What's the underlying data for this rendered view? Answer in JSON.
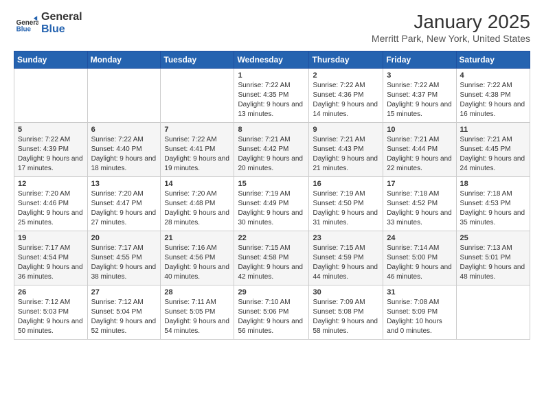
{
  "header": {
    "logo_general": "General",
    "logo_blue": "Blue",
    "title": "January 2025",
    "location": "Merritt Park, New York, United States"
  },
  "days_of_week": [
    "Sunday",
    "Monday",
    "Tuesday",
    "Wednesday",
    "Thursday",
    "Friday",
    "Saturday"
  ],
  "weeks": [
    [
      {
        "day": "",
        "sunrise": "",
        "sunset": "",
        "daylight": ""
      },
      {
        "day": "",
        "sunrise": "",
        "sunset": "",
        "daylight": ""
      },
      {
        "day": "",
        "sunrise": "",
        "sunset": "",
        "daylight": ""
      },
      {
        "day": "1",
        "sunrise": "Sunrise: 7:22 AM",
        "sunset": "Sunset: 4:35 PM",
        "daylight": "Daylight: 9 hours and 13 minutes."
      },
      {
        "day": "2",
        "sunrise": "Sunrise: 7:22 AM",
        "sunset": "Sunset: 4:36 PM",
        "daylight": "Daylight: 9 hours and 14 minutes."
      },
      {
        "day": "3",
        "sunrise": "Sunrise: 7:22 AM",
        "sunset": "Sunset: 4:37 PM",
        "daylight": "Daylight: 9 hours and 15 minutes."
      },
      {
        "day": "4",
        "sunrise": "Sunrise: 7:22 AM",
        "sunset": "Sunset: 4:38 PM",
        "daylight": "Daylight: 9 hours and 16 minutes."
      }
    ],
    [
      {
        "day": "5",
        "sunrise": "Sunrise: 7:22 AM",
        "sunset": "Sunset: 4:39 PM",
        "daylight": "Daylight: 9 hours and 17 minutes."
      },
      {
        "day": "6",
        "sunrise": "Sunrise: 7:22 AM",
        "sunset": "Sunset: 4:40 PM",
        "daylight": "Daylight: 9 hours and 18 minutes."
      },
      {
        "day": "7",
        "sunrise": "Sunrise: 7:22 AM",
        "sunset": "Sunset: 4:41 PM",
        "daylight": "Daylight: 9 hours and 19 minutes."
      },
      {
        "day": "8",
        "sunrise": "Sunrise: 7:21 AM",
        "sunset": "Sunset: 4:42 PM",
        "daylight": "Daylight: 9 hours and 20 minutes."
      },
      {
        "day": "9",
        "sunrise": "Sunrise: 7:21 AM",
        "sunset": "Sunset: 4:43 PM",
        "daylight": "Daylight: 9 hours and 21 minutes."
      },
      {
        "day": "10",
        "sunrise": "Sunrise: 7:21 AM",
        "sunset": "Sunset: 4:44 PM",
        "daylight": "Daylight: 9 hours and 22 minutes."
      },
      {
        "day": "11",
        "sunrise": "Sunrise: 7:21 AM",
        "sunset": "Sunset: 4:45 PM",
        "daylight": "Daylight: 9 hours and 24 minutes."
      }
    ],
    [
      {
        "day": "12",
        "sunrise": "Sunrise: 7:20 AM",
        "sunset": "Sunset: 4:46 PM",
        "daylight": "Daylight: 9 hours and 25 minutes."
      },
      {
        "day": "13",
        "sunrise": "Sunrise: 7:20 AM",
        "sunset": "Sunset: 4:47 PM",
        "daylight": "Daylight: 9 hours and 27 minutes."
      },
      {
        "day": "14",
        "sunrise": "Sunrise: 7:20 AM",
        "sunset": "Sunset: 4:48 PM",
        "daylight": "Daylight: 9 hours and 28 minutes."
      },
      {
        "day": "15",
        "sunrise": "Sunrise: 7:19 AM",
        "sunset": "Sunset: 4:49 PM",
        "daylight": "Daylight: 9 hours and 30 minutes."
      },
      {
        "day": "16",
        "sunrise": "Sunrise: 7:19 AM",
        "sunset": "Sunset: 4:50 PM",
        "daylight": "Daylight: 9 hours and 31 minutes."
      },
      {
        "day": "17",
        "sunrise": "Sunrise: 7:18 AM",
        "sunset": "Sunset: 4:52 PM",
        "daylight": "Daylight: 9 hours and 33 minutes."
      },
      {
        "day": "18",
        "sunrise": "Sunrise: 7:18 AM",
        "sunset": "Sunset: 4:53 PM",
        "daylight": "Daylight: 9 hours and 35 minutes."
      }
    ],
    [
      {
        "day": "19",
        "sunrise": "Sunrise: 7:17 AM",
        "sunset": "Sunset: 4:54 PM",
        "daylight": "Daylight: 9 hours and 36 minutes."
      },
      {
        "day": "20",
        "sunrise": "Sunrise: 7:17 AM",
        "sunset": "Sunset: 4:55 PM",
        "daylight": "Daylight: 9 hours and 38 minutes."
      },
      {
        "day": "21",
        "sunrise": "Sunrise: 7:16 AM",
        "sunset": "Sunset: 4:56 PM",
        "daylight": "Daylight: 9 hours and 40 minutes."
      },
      {
        "day": "22",
        "sunrise": "Sunrise: 7:15 AM",
        "sunset": "Sunset: 4:58 PM",
        "daylight": "Daylight: 9 hours and 42 minutes."
      },
      {
        "day": "23",
        "sunrise": "Sunrise: 7:15 AM",
        "sunset": "Sunset: 4:59 PM",
        "daylight": "Daylight: 9 hours and 44 minutes."
      },
      {
        "day": "24",
        "sunrise": "Sunrise: 7:14 AM",
        "sunset": "Sunset: 5:00 PM",
        "daylight": "Daylight: 9 hours and 46 minutes."
      },
      {
        "day": "25",
        "sunrise": "Sunrise: 7:13 AM",
        "sunset": "Sunset: 5:01 PM",
        "daylight": "Daylight: 9 hours and 48 minutes."
      }
    ],
    [
      {
        "day": "26",
        "sunrise": "Sunrise: 7:12 AM",
        "sunset": "Sunset: 5:03 PM",
        "daylight": "Daylight: 9 hours and 50 minutes."
      },
      {
        "day": "27",
        "sunrise": "Sunrise: 7:12 AM",
        "sunset": "Sunset: 5:04 PM",
        "daylight": "Daylight: 9 hours and 52 minutes."
      },
      {
        "day": "28",
        "sunrise": "Sunrise: 7:11 AM",
        "sunset": "Sunset: 5:05 PM",
        "daylight": "Daylight: 9 hours and 54 minutes."
      },
      {
        "day": "29",
        "sunrise": "Sunrise: 7:10 AM",
        "sunset": "Sunset: 5:06 PM",
        "daylight": "Daylight: 9 hours and 56 minutes."
      },
      {
        "day": "30",
        "sunrise": "Sunrise: 7:09 AM",
        "sunset": "Sunset: 5:08 PM",
        "daylight": "Daylight: 9 hours and 58 minutes."
      },
      {
        "day": "31",
        "sunrise": "Sunrise: 7:08 AM",
        "sunset": "Sunset: 5:09 PM",
        "daylight": "Daylight: 10 hours and 0 minutes."
      },
      {
        "day": "",
        "sunrise": "",
        "sunset": "",
        "daylight": ""
      }
    ]
  ]
}
